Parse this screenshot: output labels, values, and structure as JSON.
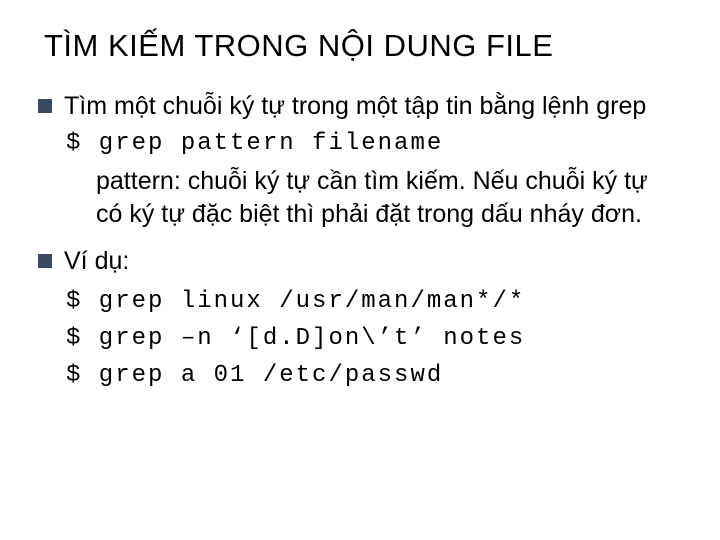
{
  "title": "TÌM KIẾM TRONG NỘI DUNG FILE",
  "bullet1": "Tìm một chuỗi ký tự trong một tập tin bằng lệnh grep",
  "code1": "$ grep pattern filename",
  "pattern_desc": "pattern: chuỗi ký tự cần tìm kiếm. Nếu chuỗi ký tự có ký tự đặc biệt thì phải đặt trong dấu nháy đơn.",
  "bullet2": "Ví dụ:",
  "ex1": "$ grep linux /usr/man/man*/*",
  "ex2": "$ grep –n ‘[d.D]on\\’t’ notes",
  "ex3": "$ grep a 01 /etc/passwd"
}
